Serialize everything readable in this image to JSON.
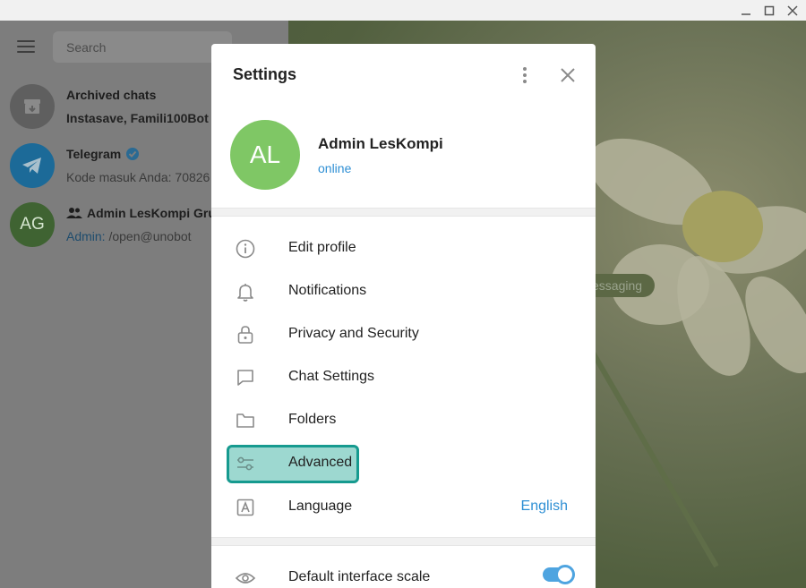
{
  "sidebar": {
    "search_placeholder": "Search",
    "chats": [
      {
        "title": "Archived chats",
        "subtitle": "Instasave, Famili100Bot"
      },
      {
        "title": "Telegram",
        "subtitle": "Kode masuk Anda: 70826"
      },
      {
        "avatar": "AG",
        "title": "Admin LesKompi Gru",
        "subtitle_prefix": "Admin:",
        "subtitle": " /open@unobot"
      }
    ]
  },
  "wallpaper": {
    "service_message": "essaging"
  },
  "settings": {
    "title": "Settings",
    "profile": {
      "initials": "AL",
      "name": "Admin LesKompi",
      "status": "online"
    },
    "menu": [
      {
        "label": "Edit profile",
        "icon": "info-icon"
      },
      {
        "label": "Notifications",
        "icon": "bell-icon"
      },
      {
        "label": "Privacy and Security",
        "icon": "lock-icon"
      },
      {
        "label": "Chat Settings",
        "icon": "chat-bubble-icon"
      },
      {
        "label": "Folders",
        "icon": "folder-icon"
      },
      {
        "label": "Advanced",
        "icon": "sliders-icon"
      },
      {
        "label": "Language",
        "icon": "language-icon",
        "value": "English"
      }
    ],
    "scale": {
      "label": "Default interface scale",
      "icon": "eye-icon",
      "enabled": true
    }
  },
  "colors": {
    "accent": "#2e8fd4",
    "avatar_green": "#7fc765",
    "highlight_fill": "#9dd8d0",
    "highlight_border": "#169a8f"
  }
}
